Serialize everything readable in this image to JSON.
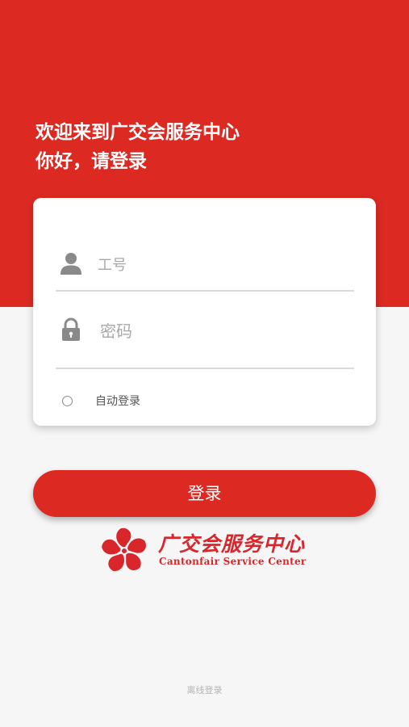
{
  "header": {
    "welcome_line": "欢迎来到广交会服务中心",
    "greeting_line": "你好，请登录"
  },
  "login_form": {
    "employee_id": {
      "value": "",
      "placeholder": "工号",
      "icon": "user-icon"
    },
    "password": {
      "value": "",
      "placeholder": "密码",
      "icon": "lock-icon"
    },
    "auto_login": {
      "label": "自动登录",
      "checked": false
    }
  },
  "login_button": {
    "label": "登录"
  },
  "brand": {
    "name_cn": "广交会服务中心",
    "name_en": "Cantonfair Service Center",
    "logo_icon": "canton-fair-flower-logo"
  },
  "offline_login": {
    "label": "离线登录"
  },
  "colors": {
    "brand_red": "#dc2a23",
    "background": "#f6f6f6",
    "card": "#ffffff",
    "icon_gray": "#8a8a8a"
  }
}
